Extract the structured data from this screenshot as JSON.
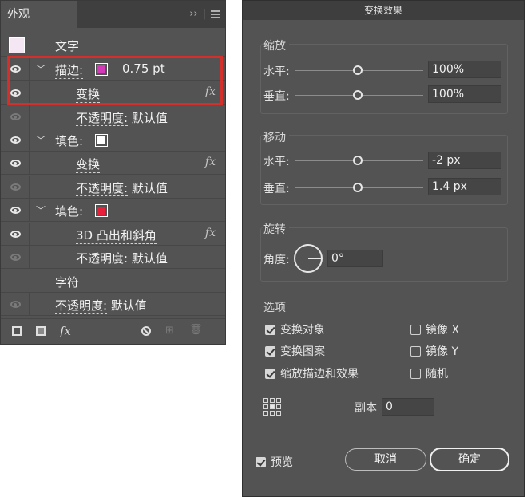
{
  "appearance_panel": {
    "tab_label": "外观",
    "expand_glyph": "››",
    "rows": {
      "text": "文字",
      "stroke_label": "描边:",
      "stroke_weight": "0.75 pt",
      "stroke_transform": "变换",
      "stroke_opacity_label": "不透明度:",
      "stroke_opacity_value": "默认值",
      "fill1_label": "填色:",
      "fill1_transform": "变换",
      "fill1_opacity_label": "不透明度:",
      "fill1_opacity_value": "默认值",
      "fill2_label": "填色:",
      "fill2_effect": "3D 凸出和斜角",
      "fill2_opacity_label": "不透明度:",
      "fill2_opacity_value": "默认值",
      "characters": "字符",
      "overall_opacity_label": "不透明度:",
      "overall_opacity_value": "默认值"
    },
    "fx_glyph": "fx",
    "colors": {
      "stroke": "#d23ab8",
      "fill1": "#ffffff",
      "fill2": "#e8203a",
      "highlight": "#d3302c"
    }
  },
  "dialog": {
    "title": "变换效果",
    "scale": {
      "heading": "缩放",
      "horizontal_label": "水平:",
      "horizontal_value": "100%",
      "vertical_label": "垂直:",
      "vertical_value": "100%"
    },
    "move": {
      "heading": "移动",
      "horizontal_label": "水平:",
      "horizontal_value": "-2 px",
      "vertical_label": "垂直:",
      "vertical_value": "1.4 px"
    },
    "rotate": {
      "heading": "旋转",
      "angle_label": "角度:",
      "angle_value": "0°"
    },
    "options": {
      "heading": "选项",
      "transform_objects": "变换对象",
      "transform_patterns": "变换图案",
      "scale_strokes_effects": "缩放描边和效果",
      "reflect_x": "镜像 X",
      "reflect_y": "镜像 Y",
      "random": "随机"
    },
    "copies_label": "副本",
    "copies_value": "0",
    "preview_label": "预览",
    "cancel_label": "取消",
    "ok_label": "确定"
  }
}
